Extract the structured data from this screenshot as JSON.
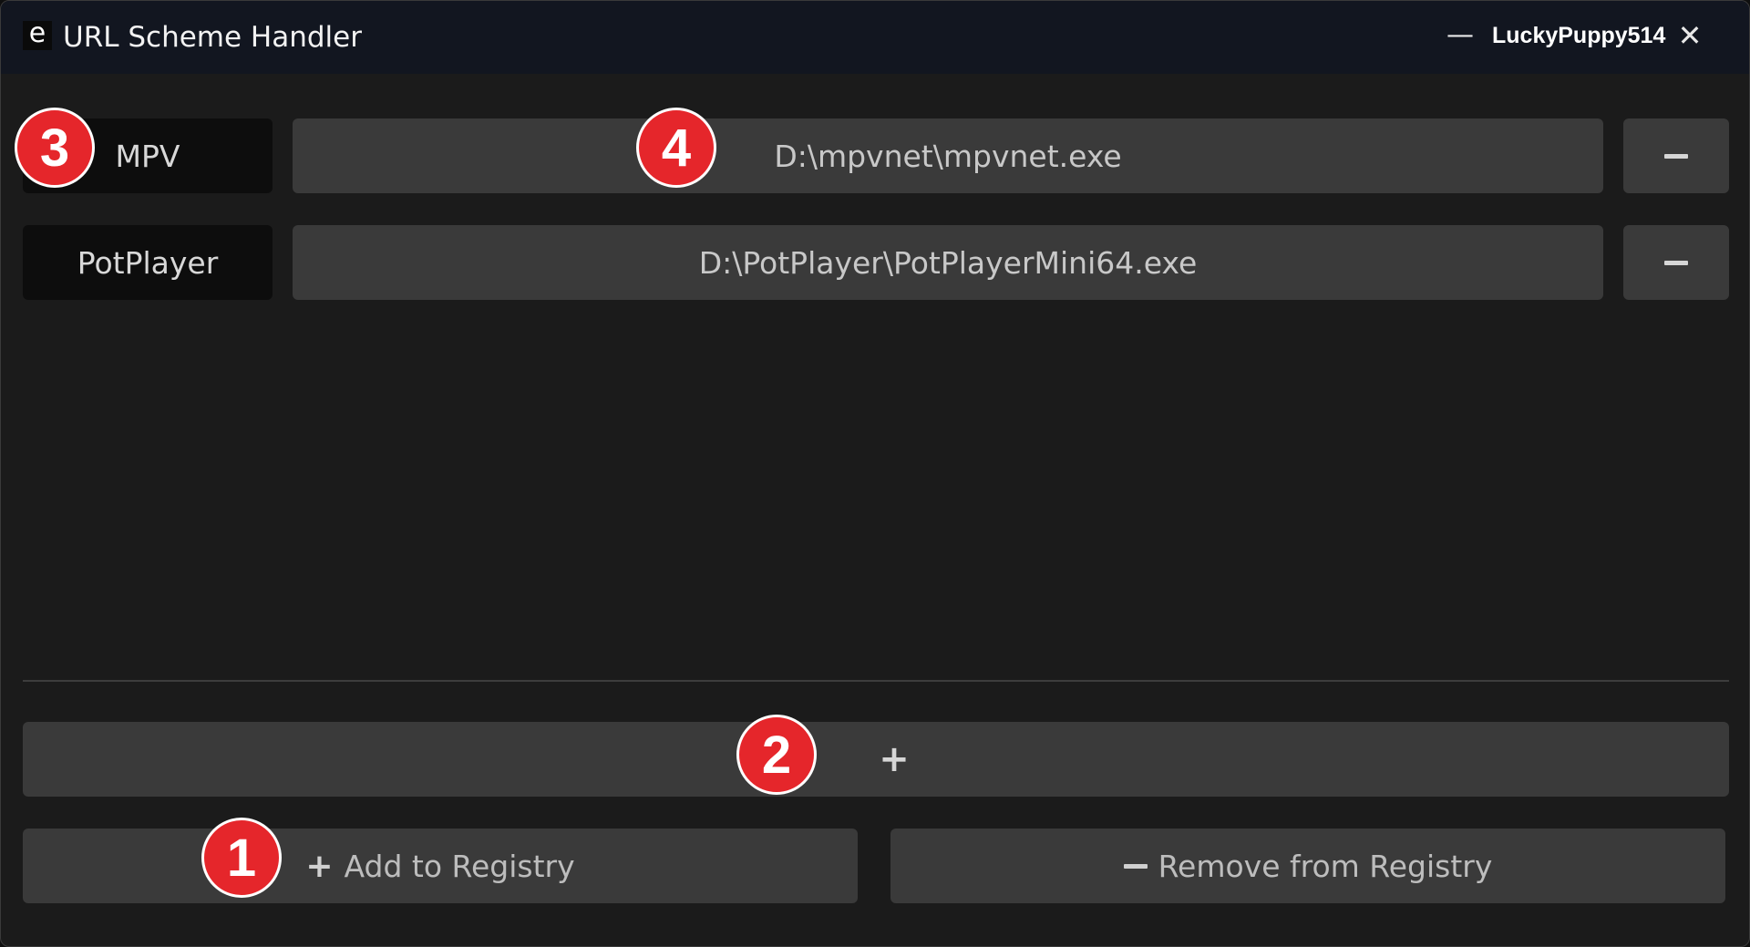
{
  "titlebar": {
    "icon_glyph": "e",
    "title": "URL Scheme Handler",
    "minimize_glyph": "—",
    "user": "LuckyPuppy514",
    "close_glyph": "✕"
  },
  "rows": [
    {
      "name": "MPV",
      "path": "D:\\mpvnet\\mpvnet.exe"
    },
    {
      "name": "PotPlayer",
      "path": "D:\\PotPlayer\\PotPlayerMini64.exe"
    }
  ],
  "add_row_label": "+",
  "registry": {
    "add_symbol": "+",
    "add_label": "Add to Registry",
    "remove_label": "Remove from Registry"
  },
  "badges": [
    "1",
    "2",
    "3",
    "4"
  ],
  "colors": {
    "badge": "#e5262b",
    "titlebar": "#121620",
    "window": "#1b1b1b",
    "field": "#3a3a3a"
  },
  "icons": {
    "app": "app-e-icon",
    "minimize": "minimize-icon",
    "close": "close-icon",
    "remove_row": "minus-icon",
    "add_row": "plus-icon"
  }
}
